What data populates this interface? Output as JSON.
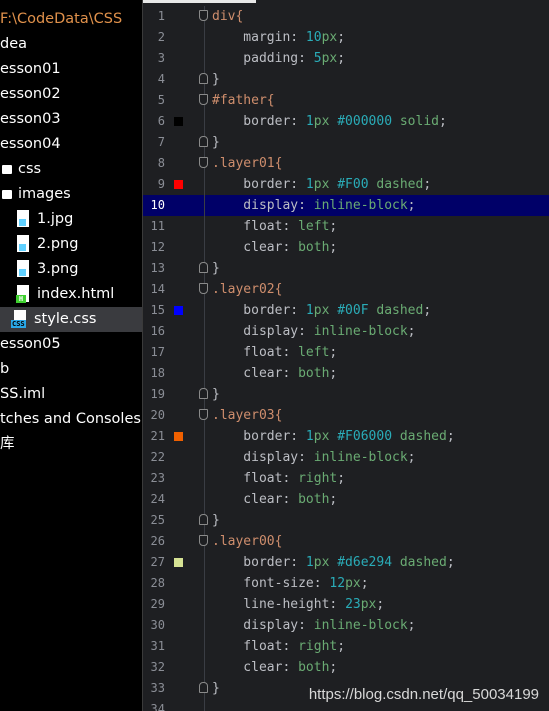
{
  "sidebar": {
    "items": [
      {
        "label": "F:\\CodeData\\CSS",
        "type": "root"
      },
      {
        "label": "dea",
        "type": "plain"
      },
      {
        "label": "esson01",
        "type": "plain"
      },
      {
        "label": "esson02",
        "type": "plain"
      },
      {
        "label": "esson03",
        "type": "plain"
      },
      {
        "label": "esson04",
        "type": "plain"
      },
      {
        "label": "css",
        "type": "folder"
      },
      {
        "label": "images",
        "type": "folder"
      },
      {
        "label": "1.jpg",
        "type": "img"
      },
      {
        "label": "2.png",
        "type": "img"
      },
      {
        "label": "3.png",
        "type": "img"
      },
      {
        "label": "index.html",
        "type": "html"
      },
      {
        "label": "style.css",
        "type": "css",
        "selected": true
      },
      {
        "label": "esson05",
        "type": "plain"
      },
      {
        "label": "b",
        "type": "plain"
      },
      {
        "label": "SS.iml",
        "type": "plain"
      },
      {
        "label": "tches and Consoles",
        "type": "plain"
      },
      {
        "label": "库",
        "type": "plain"
      }
    ]
  },
  "editor": {
    "highlighted_line": 10,
    "lines": [
      {
        "n": "1",
        "tokens": [
          [
            "sel",
            "div{"
          ]
        ],
        "fold": "open"
      },
      {
        "n": "2",
        "tokens": [
          [
            "prop",
            "    margin: "
          ],
          [
            "num",
            "10"
          ],
          [
            "unit",
            "px"
          ],
          [
            "pun",
            ";"
          ]
        ]
      },
      {
        "n": "3",
        "tokens": [
          [
            "prop",
            "    padding: "
          ],
          [
            "num",
            "5"
          ],
          [
            "unit",
            "px"
          ],
          [
            "pun",
            ";"
          ]
        ]
      },
      {
        "n": "4",
        "tokens": [
          [
            "pun",
            "}"
          ]
        ],
        "fold": "close"
      },
      {
        "n": "5",
        "tokens": [
          [
            "sel",
            "#father{"
          ]
        ],
        "fold": "open"
      },
      {
        "n": "6",
        "tokens": [
          [
            "prop",
            "    border: "
          ],
          [
            "num",
            "1"
          ],
          [
            "unit",
            "px "
          ],
          [
            "hex",
            "#000000"
          ],
          [
            "kw",
            " solid"
          ],
          [
            "pun",
            ";"
          ]
        ],
        "swatch": "#000000"
      },
      {
        "n": "7",
        "tokens": [
          [
            "pun",
            "}"
          ]
        ],
        "fold": "close"
      },
      {
        "n": "8",
        "tokens": [
          [
            "sel",
            ".layer01{"
          ]
        ],
        "fold": "open"
      },
      {
        "n": "9",
        "tokens": [
          [
            "prop",
            "    border: "
          ],
          [
            "num",
            "1"
          ],
          [
            "unit",
            "px "
          ],
          [
            "hex",
            "#F00"
          ],
          [
            "kw",
            " dashed"
          ],
          [
            "pun",
            ";"
          ]
        ],
        "swatch": "#ff0000"
      },
      {
        "n": "10",
        "tokens": [
          [
            "prop",
            "    display: "
          ],
          [
            "kw",
            "inline-block"
          ],
          [
            "pun",
            ";"
          ]
        ]
      },
      {
        "n": "11",
        "tokens": [
          [
            "prop",
            "    float: "
          ],
          [
            "kw",
            "left"
          ],
          [
            "pun",
            ";"
          ]
        ]
      },
      {
        "n": "12",
        "tokens": [
          [
            "prop",
            "    clear: "
          ],
          [
            "kw",
            "both"
          ],
          [
            "pun",
            ";"
          ]
        ]
      },
      {
        "n": "13",
        "tokens": [
          [
            "pun",
            "}"
          ]
        ],
        "fold": "close"
      },
      {
        "n": "14",
        "tokens": [
          [
            "sel",
            ".layer02{"
          ]
        ],
        "fold": "open"
      },
      {
        "n": "15",
        "tokens": [
          [
            "prop",
            "    border: "
          ],
          [
            "num",
            "1"
          ],
          [
            "unit",
            "px "
          ],
          [
            "hex",
            "#00F"
          ],
          [
            "kw",
            " dashed"
          ],
          [
            "pun",
            ";"
          ]
        ],
        "swatch": "#0000ff"
      },
      {
        "n": "16",
        "tokens": [
          [
            "prop",
            "    display: "
          ],
          [
            "kw",
            "inline-block"
          ],
          [
            "pun",
            ";"
          ]
        ]
      },
      {
        "n": "17",
        "tokens": [
          [
            "prop",
            "    float: "
          ],
          [
            "kw",
            "left"
          ],
          [
            "pun",
            ";"
          ]
        ]
      },
      {
        "n": "18",
        "tokens": [
          [
            "prop",
            "    clear: "
          ],
          [
            "kw",
            "both"
          ],
          [
            "pun",
            ";"
          ]
        ]
      },
      {
        "n": "19",
        "tokens": [
          [
            "pun",
            "}"
          ]
        ],
        "fold": "close"
      },
      {
        "n": "20",
        "tokens": [
          [
            "sel",
            ".layer03{"
          ]
        ],
        "fold": "open"
      },
      {
        "n": "21",
        "tokens": [
          [
            "prop",
            "    border: "
          ],
          [
            "num",
            "1"
          ],
          [
            "unit",
            "px "
          ],
          [
            "hex",
            "#F06000"
          ],
          [
            "kw",
            " dashed"
          ],
          [
            "pun",
            ";"
          ]
        ],
        "swatch": "#f06000"
      },
      {
        "n": "22",
        "tokens": [
          [
            "prop",
            "    display: "
          ],
          [
            "kw",
            "inline-block"
          ],
          [
            "pun",
            ";"
          ]
        ]
      },
      {
        "n": "23",
        "tokens": [
          [
            "prop",
            "    float: "
          ],
          [
            "kw",
            "right"
          ],
          [
            "pun",
            ";"
          ]
        ]
      },
      {
        "n": "24",
        "tokens": [
          [
            "prop",
            "    clear: "
          ],
          [
            "kw",
            "both"
          ],
          [
            "pun",
            ";"
          ]
        ]
      },
      {
        "n": "25",
        "tokens": [
          [
            "pun",
            "}"
          ]
        ],
        "fold": "close"
      },
      {
        "n": "26",
        "tokens": [
          [
            "sel",
            ".layer00{"
          ]
        ],
        "fold": "open"
      },
      {
        "n": "27",
        "tokens": [
          [
            "prop",
            "    border: "
          ],
          [
            "num",
            "1"
          ],
          [
            "unit",
            "px "
          ],
          [
            "hex",
            "#d6e294"
          ],
          [
            "kw",
            " dashed"
          ],
          [
            "pun",
            ";"
          ]
        ],
        "swatch": "#d6e294"
      },
      {
        "n": "28",
        "tokens": [
          [
            "prop",
            "    font-size: "
          ],
          [
            "num",
            "12"
          ],
          [
            "unit",
            "px"
          ],
          [
            "pun",
            ";"
          ]
        ]
      },
      {
        "n": "29",
        "tokens": [
          [
            "prop",
            "    line-height: "
          ],
          [
            "num",
            "23"
          ],
          [
            "unit",
            "px"
          ],
          [
            "pun",
            ";"
          ]
        ]
      },
      {
        "n": "30",
        "tokens": [
          [
            "prop",
            "    display: "
          ],
          [
            "kw",
            "inline-block"
          ],
          [
            "pun",
            ";"
          ]
        ]
      },
      {
        "n": "31",
        "tokens": [
          [
            "prop",
            "    float: "
          ],
          [
            "kw",
            "right"
          ],
          [
            "pun",
            ";"
          ]
        ]
      },
      {
        "n": "32",
        "tokens": [
          [
            "prop",
            "    clear: "
          ],
          [
            "kw",
            "both"
          ],
          [
            "pun",
            ";"
          ]
        ]
      },
      {
        "n": "33",
        "tokens": [
          [
            "pun",
            "}"
          ]
        ],
        "fold": "close"
      },
      {
        "n": "34",
        "tokens": []
      }
    ]
  },
  "watermark": "https://blog.csdn.net/qq_50034199"
}
